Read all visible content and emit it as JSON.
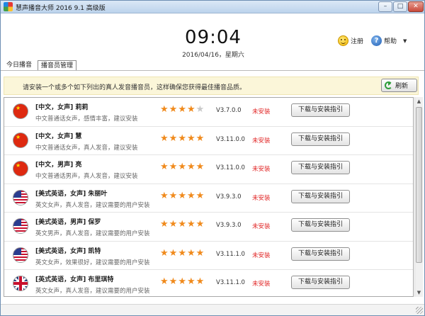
{
  "window": {
    "title": "慧声播音大师 2016 9.1 高级版",
    "minimize_glyph": "–",
    "maximize_glyph": "□",
    "close_glyph": "✕"
  },
  "header": {
    "time": "09:04",
    "date": "2016/04/16，星期六",
    "register_label": "注册",
    "help_label": "帮助",
    "help_glyph": "?",
    "dropdown_glyph": "▼"
  },
  "tabs": [
    {
      "label": "今日播音",
      "active": false
    },
    {
      "label": "播音员管理",
      "active": true
    }
  ],
  "notice": {
    "text": "请安装一个或多个如下列出的真人发音播音员，这样确保您获得最佳播音品质。",
    "refresh_label": "刷新"
  },
  "voices": [
    {
      "flag": "cn",
      "name": "[中文，女声] 莉莉",
      "desc": "中文普通话女声，感情丰富，建议安装",
      "rating": 4,
      "version": "V3.7.0.0",
      "status": "未安装",
      "button": "下载与安装指引"
    },
    {
      "flag": "cn",
      "name": "[中文，女声] 慧",
      "desc": "中文普通话女声，真人发音，建议安装",
      "rating": 5,
      "version": "V3.11.0.0",
      "status": "未安装",
      "button": "下载与安装指引"
    },
    {
      "flag": "cn",
      "name": "[中文，男声] 亮",
      "desc": "中文普通话男声，真人发音，建议安装",
      "rating": 5,
      "version": "V3.11.0.0",
      "status": "未安装",
      "button": "下载与安装指引"
    },
    {
      "flag": "us",
      "name": "[美式英语，女声] 朱丽叶",
      "desc": "英文女声，真人发音，建议需要的用户安装",
      "rating": 5,
      "version": "V3.9.3.0",
      "status": "未安装",
      "button": "下载与安装指引"
    },
    {
      "flag": "us",
      "name": "[美式英语，男声] 保罗",
      "desc": "英文男声，真人发音，建议需要的用户安装",
      "rating": 5,
      "version": "V3.9.3.0",
      "status": "未安装",
      "button": "下载与安装指引"
    },
    {
      "flag": "us",
      "name": "[美式英语，女声] 凯特",
      "desc": "英文女声，效果很好，建议需要的用户安装",
      "rating": 5,
      "version": "V3.11.1.0",
      "status": "未安装",
      "button": "下载与安装指引"
    },
    {
      "flag": "uk",
      "name": "[英式英语，女声] 布里琪特",
      "desc": "英文女声，真人发音，建议需要的用户安装",
      "rating": 5,
      "version": "V3.11.1.0",
      "status": "未安装",
      "button": "下载与安装指引"
    }
  ],
  "scrollbar": {
    "up_glyph": "▲",
    "down_glyph": "▼"
  }
}
